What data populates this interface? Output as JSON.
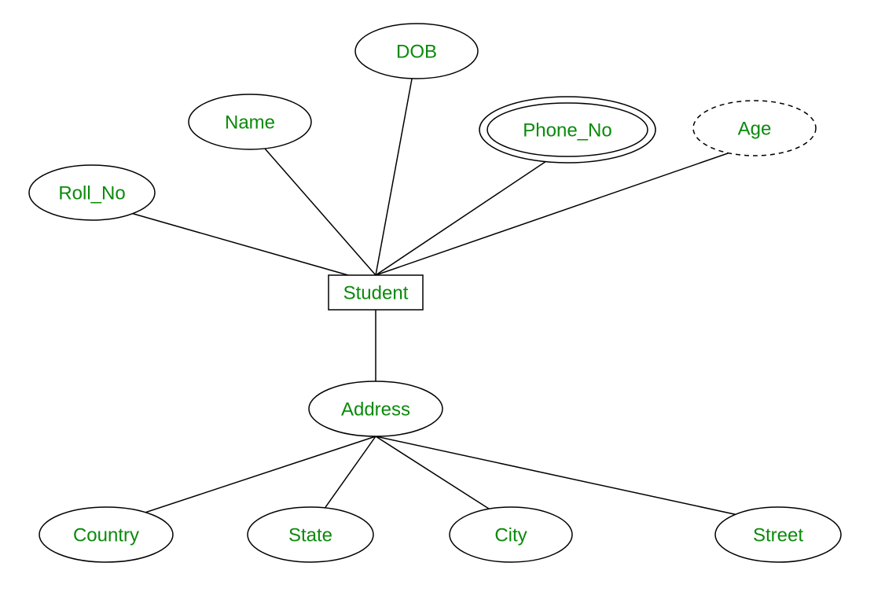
{
  "diagram": {
    "type": "er-diagram",
    "entity": {
      "name": "Student"
    },
    "attributes": {
      "roll_no": {
        "label": "Roll_No",
        "kind": "simple"
      },
      "name": {
        "label": "Name",
        "kind": "simple"
      },
      "dob": {
        "label": "DOB",
        "kind": "simple"
      },
      "phone_no": {
        "label": "Phone_No",
        "kind": "multivalued"
      },
      "age": {
        "label": "Age",
        "kind": "derived"
      },
      "address": {
        "label": "Address",
        "kind": "composite"
      }
    },
    "address_components": {
      "country": {
        "label": "Country"
      },
      "state": {
        "label": "State"
      },
      "city": {
        "label": "City"
      },
      "street": {
        "label": "Street"
      }
    }
  }
}
